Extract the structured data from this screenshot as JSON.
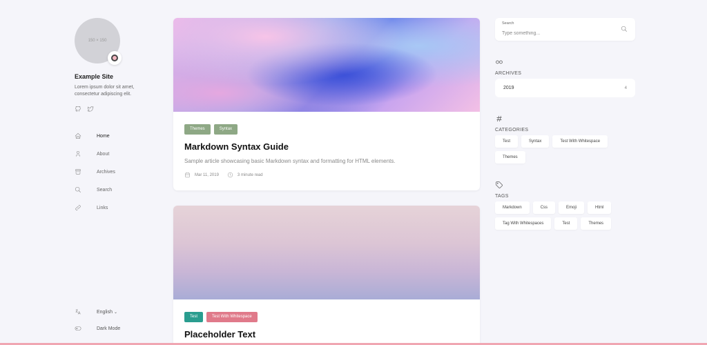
{
  "site": {
    "avatar_text": "150 × 150",
    "name": "Example Site",
    "description": "Lorem ipsum dolor sit amet, consectetur adipiscing elit."
  },
  "social": [
    {
      "icon": "github-icon"
    },
    {
      "icon": "twitter-icon"
    }
  ],
  "nav": [
    {
      "label": "Home",
      "icon": "home-icon",
      "active": true
    },
    {
      "label": "About",
      "icon": "user-icon",
      "active": false
    },
    {
      "label": "Archives",
      "icon": "archive-icon",
      "active": false
    },
    {
      "label": "Search",
      "icon": "search-icon",
      "active": false
    },
    {
      "label": "Links",
      "icon": "link-icon",
      "active": false
    }
  ],
  "controls": {
    "language": "English",
    "dark_mode": "Dark Mode"
  },
  "posts": [
    {
      "categories": [
        {
          "label": "Themes",
          "color": "#8ea885"
        },
        {
          "label": "Syntax",
          "color": "#8ea885"
        }
      ],
      "title": "Markdown Syntax Guide",
      "summary": "Sample article showcasing basic Markdown syntax and formatting for HTML elements.",
      "date": "Mar 11, 2019",
      "reading_time": "3 minute read"
    },
    {
      "categories": [
        {
          "label": "Test",
          "color": "#2a9d8f"
        },
        {
          "label": "Test With Whitespace",
          "color": "#e07a8a"
        }
      ],
      "title": "Placeholder Text"
    }
  ],
  "search": {
    "label": "Search",
    "placeholder": "Type something..."
  },
  "archives": {
    "title": "ARCHIVES",
    "year": "2019",
    "count": "4"
  },
  "categories": {
    "title": "CATEGORIES",
    "items": [
      "Test",
      "Syntax",
      "Test With Whitespace",
      "Themes"
    ]
  },
  "tags": {
    "title": "TAGS",
    "items": [
      "Markdown",
      "Css",
      "Emoji",
      "Html",
      "Tag With Whitespaces",
      "Test",
      "Themes"
    ]
  }
}
